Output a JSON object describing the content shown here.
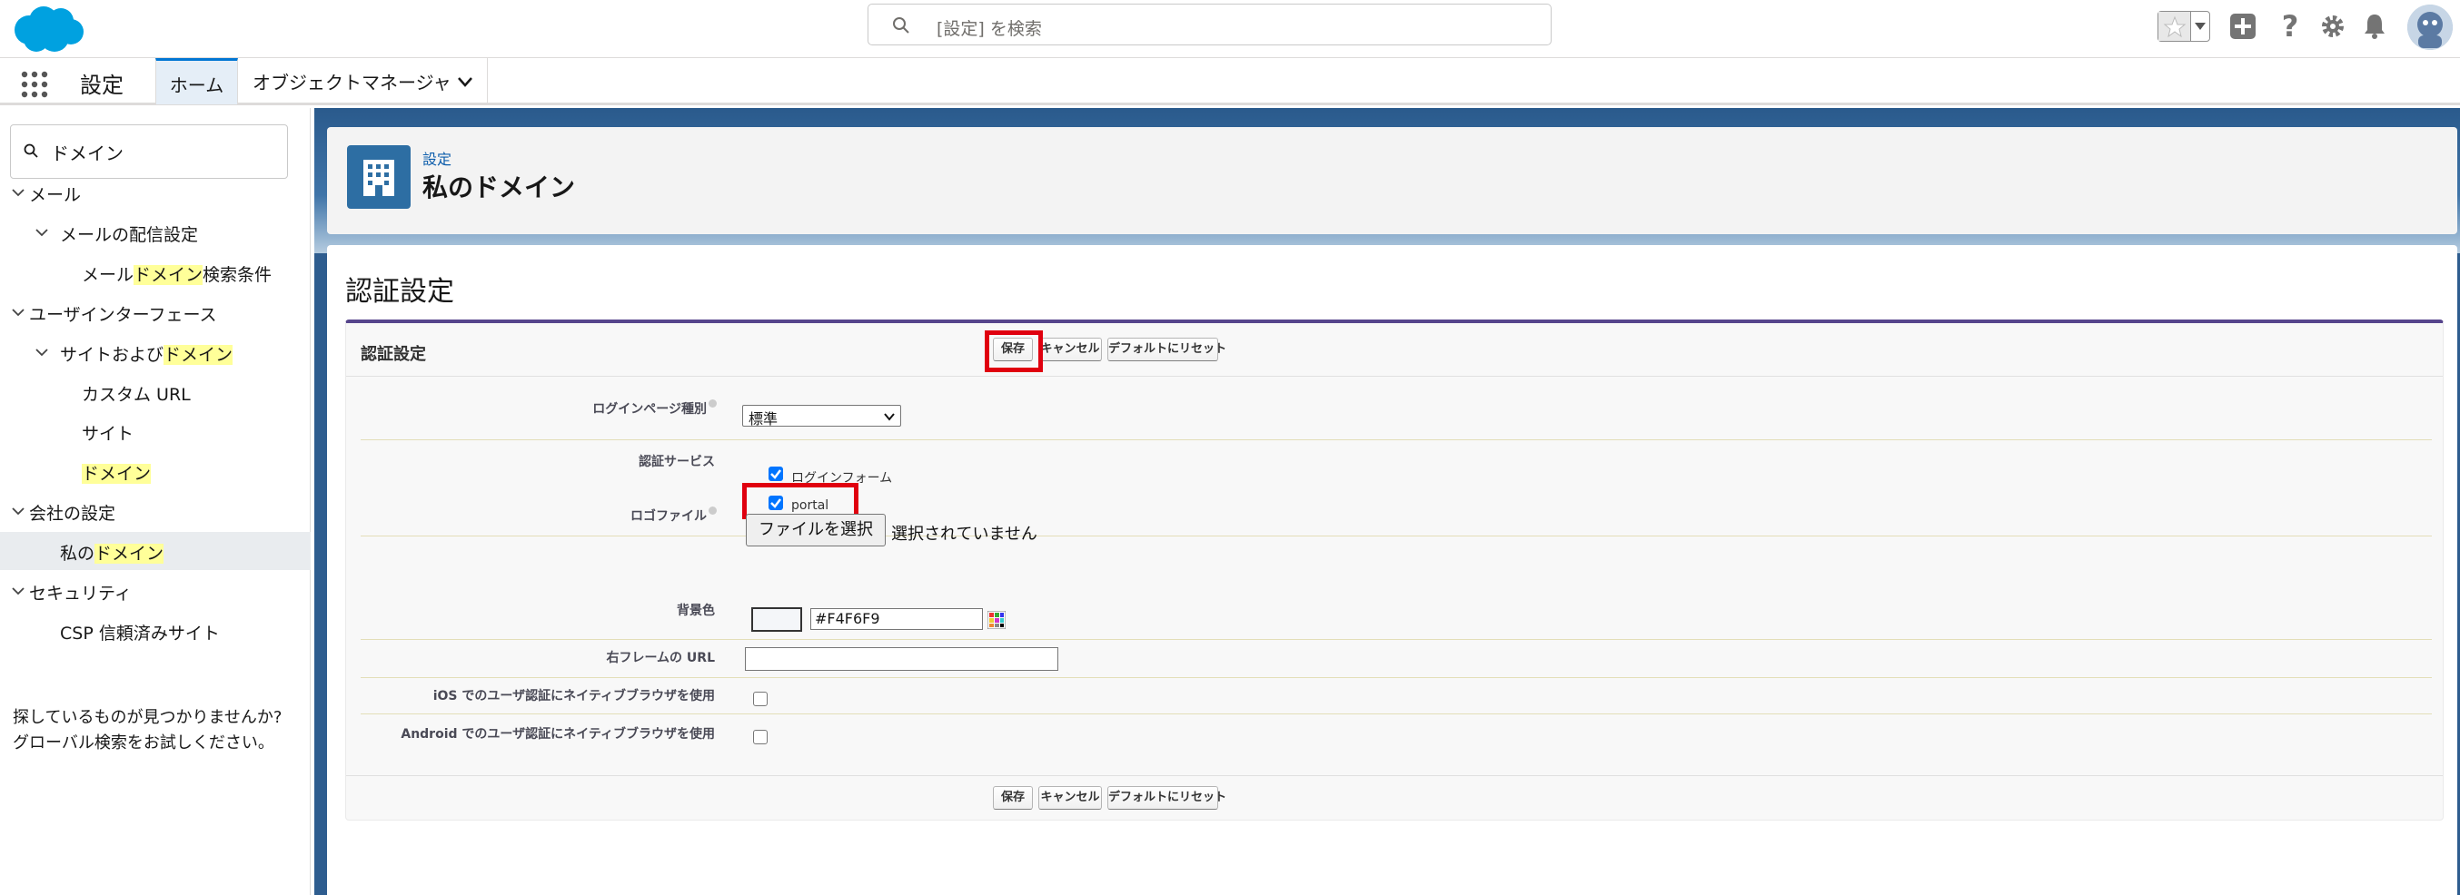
{
  "header": {
    "search_placeholder": "[設定] を検索"
  },
  "app_nav": {
    "app_name": "設定",
    "tabs": [
      {
        "label": "ホーム"
      },
      {
        "label": "オブジェクトマネージャ"
      }
    ]
  },
  "sidebar": {
    "quickfind_value": "ドメイン",
    "items": [
      {
        "pre": "メール",
        "hl": "",
        "post": ""
      },
      {
        "pre": "メールの配信設定",
        "hl": "",
        "post": ""
      },
      {
        "pre": "メール",
        "hl": "ドメイン",
        "post": "検索条件"
      },
      {
        "pre": "ユーザインターフェース",
        "hl": "",
        "post": ""
      },
      {
        "pre": "サイトおよび",
        "hl": "ドメイン",
        "post": ""
      },
      {
        "pre": "カスタム URL",
        "hl": "",
        "post": ""
      },
      {
        "pre": "サイト",
        "hl": "",
        "post": ""
      },
      {
        "pre": "",
        "hl": "ドメイン",
        "post": ""
      },
      {
        "pre": "会社の設定",
        "hl": "",
        "post": ""
      },
      {
        "pre": "私の",
        "hl": "ドメイン",
        "post": ""
      },
      {
        "pre": "セキュリティ",
        "hl": "",
        "post": ""
      },
      {
        "pre": "CSP 信頼済みサイト",
        "hl": "",
        "post": ""
      }
    ],
    "help_line1": "探しているものが見つかりませんか?",
    "help_line2": "グローバル検索をお試しください。"
  },
  "page_header": {
    "breadcrumb": "設定",
    "title": "私のドメイン"
  },
  "section": {
    "title": "認証設定",
    "block_title": "認証設定",
    "buttons": {
      "save": "保存",
      "cancel": "キャンセル",
      "reset": "デフォルトにリセット"
    },
    "fields": {
      "login_page_type_label": "ログインページ種別",
      "login_page_type_value": "標準",
      "auth_service_label": "認証サービス",
      "auth_login_form": "ログインフォーム",
      "auth_portal": "portal",
      "logo_file_label": "ロゴファイル",
      "file_button": "ファイルを選択",
      "file_status": "選択されていません",
      "bg_color_label": "背景色",
      "bg_color_value": "#F4F6F9",
      "right_frame_url_label": "右フレームの URL",
      "ios_native_label": "iOS でのユーザ認証にネイティブブラウザを使用",
      "android_native_label": "Android でのユーザ認証にネイティブブラウザを使用"
    }
  },
  "colors": {
    "brand_blue": "#00a1e0",
    "nav_active": "#0176d3",
    "highlight": "#ffff99",
    "annotation_red": "#e0000f",
    "bg_color_swatch": "#f4f6f9"
  }
}
